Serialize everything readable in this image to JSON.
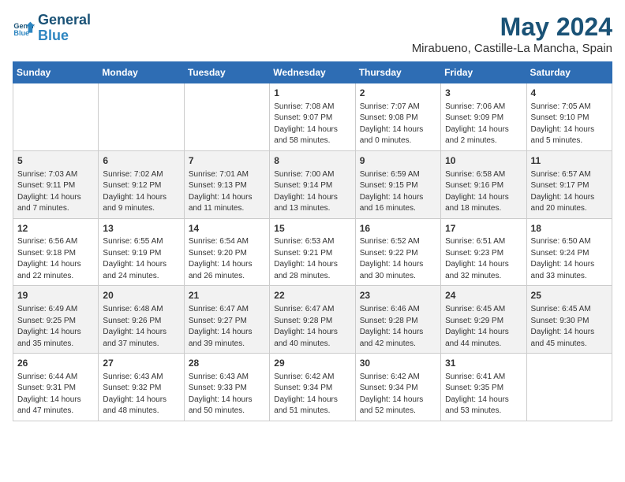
{
  "header": {
    "logo_line1": "General",
    "logo_line2": "Blue",
    "month_title": "May 2024",
    "location": "Mirabueno, Castille-La Mancha, Spain"
  },
  "weekdays": [
    "Sunday",
    "Monday",
    "Tuesday",
    "Wednesday",
    "Thursday",
    "Friday",
    "Saturday"
  ],
  "weeks": [
    [
      {
        "day": "",
        "info": ""
      },
      {
        "day": "",
        "info": ""
      },
      {
        "day": "",
        "info": ""
      },
      {
        "day": "1",
        "info": "Sunrise: 7:08 AM\nSunset: 9:07 PM\nDaylight: 14 hours\nand 58 minutes."
      },
      {
        "day": "2",
        "info": "Sunrise: 7:07 AM\nSunset: 9:08 PM\nDaylight: 14 hours\nand 0 minutes."
      },
      {
        "day": "3",
        "info": "Sunrise: 7:06 AM\nSunset: 9:09 PM\nDaylight: 14 hours\nand 2 minutes."
      },
      {
        "day": "4",
        "info": "Sunrise: 7:05 AM\nSunset: 9:10 PM\nDaylight: 14 hours\nand 5 minutes."
      }
    ],
    [
      {
        "day": "5",
        "info": "Sunrise: 7:03 AM\nSunset: 9:11 PM\nDaylight: 14 hours\nand 7 minutes."
      },
      {
        "day": "6",
        "info": "Sunrise: 7:02 AM\nSunset: 9:12 PM\nDaylight: 14 hours\nand 9 minutes."
      },
      {
        "day": "7",
        "info": "Sunrise: 7:01 AM\nSunset: 9:13 PM\nDaylight: 14 hours\nand 11 minutes."
      },
      {
        "day": "8",
        "info": "Sunrise: 7:00 AM\nSunset: 9:14 PM\nDaylight: 14 hours\nand 13 minutes."
      },
      {
        "day": "9",
        "info": "Sunrise: 6:59 AM\nSunset: 9:15 PM\nDaylight: 14 hours\nand 16 minutes."
      },
      {
        "day": "10",
        "info": "Sunrise: 6:58 AM\nSunset: 9:16 PM\nDaylight: 14 hours\nand 18 minutes."
      },
      {
        "day": "11",
        "info": "Sunrise: 6:57 AM\nSunset: 9:17 PM\nDaylight: 14 hours\nand 20 minutes."
      }
    ],
    [
      {
        "day": "12",
        "info": "Sunrise: 6:56 AM\nSunset: 9:18 PM\nDaylight: 14 hours\nand 22 minutes."
      },
      {
        "day": "13",
        "info": "Sunrise: 6:55 AM\nSunset: 9:19 PM\nDaylight: 14 hours\nand 24 minutes."
      },
      {
        "day": "14",
        "info": "Sunrise: 6:54 AM\nSunset: 9:20 PM\nDaylight: 14 hours\nand 26 minutes."
      },
      {
        "day": "15",
        "info": "Sunrise: 6:53 AM\nSunset: 9:21 PM\nDaylight: 14 hours\nand 28 minutes."
      },
      {
        "day": "16",
        "info": "Sunrise: 6:52 AM\nSunset: 9:22 PM\nDaylight: 14 hours\nand 30 minutes."
      },
      {
        "day": "17",
        "info": "Sunrise: 6:51 AM\nSunset: 9:23 PM\nDaylight: 14 hours\nand 32 minutes."
      },
      {
        "day": "18",
        "info": "Sunrise: 6:50 AM\nSunset: 9:24 PM\nDaylight: 14 hours\nand 33 minutes."
      }
    ],
    [
      {
        "day": "19",
        "info": "Sunrise: 6:49 AM\nSunset: 9:25 PM\nDaylight: 14 hours\nand 35 minutes."
      },
      {
        "day": "20",
        "info": "Sunrise: 6:48 AM\nSunset: 9:26 PM\nDaylight: 14 hours\nand 37 minutes."
      },
      {
        "day": "21",
        "info": "Sunrise: 6:47 AM\nSunset: 9:27 PM\nDaylight: 14 hours\nand 39 minutes."
      },
      {
        "day": "22",
        "info": "Sunrise: 6:47 AM\nSunset: 9:28 PM\nDaylight: 14 hours\nand 40 minutes."
      },
      {
        "day": "23",
        "info": "Sunrise: 6:46 AM\nSunset: 9:28 PM\nDaylight: 14 hours\nand 42 minutes."
      },
      {
        "day": "24",
        "info": "Sunrise: 6:45 AM\nSunset: 9:29 PM\nDaylight: 14 hours\nand 44 minutes."
      },
      {
        "day": "25",
        "info": "Sunrise: 6:45 AM\nSunset: 9:30 PM\nDaylight: 14 hours\nand 45 minutes."
      }
    ],
    [
      {
        "day": "26",
        "info": "Sunrise: 6:44 AM\nSunset: 9:31 PM\nDaylight: 14 hours\nand 47 minutes."
      },
      {
        "day": "27",
        "info": "Sunrise: 6:43 AM\nSunset: 9:32 PM\nDaylight: 14 hours\nand 48 minutes."
      },
      {
        "day": "28",
        "info": "Sunrise: 6:43 AM\nSunset: 9:33 PM\nDaylight: 14 hours\nand 50 minutes."
      },
      {
        "day": "29",
        "info": "Sunrise: 6:42 AM\nSunset: 9:34 PM\nDaylight: 14 hours\nand 51 minutes."
      },
      {
        "day": "30",
        "info": "Sunrise: 6:42 AM\nSunset: 9:34 PM\nDaylight: 14 hours\nand 52 minutes."
      },
      {
        "day": "31",
        "info": "Sunrise: 6:41 AM\nSunset: 9:35 PM\nDaylight: 14 hours\nand 53 minutes."
      },
      {
        "day": "",
        "info": ""
      }
    ]
  ]
}
